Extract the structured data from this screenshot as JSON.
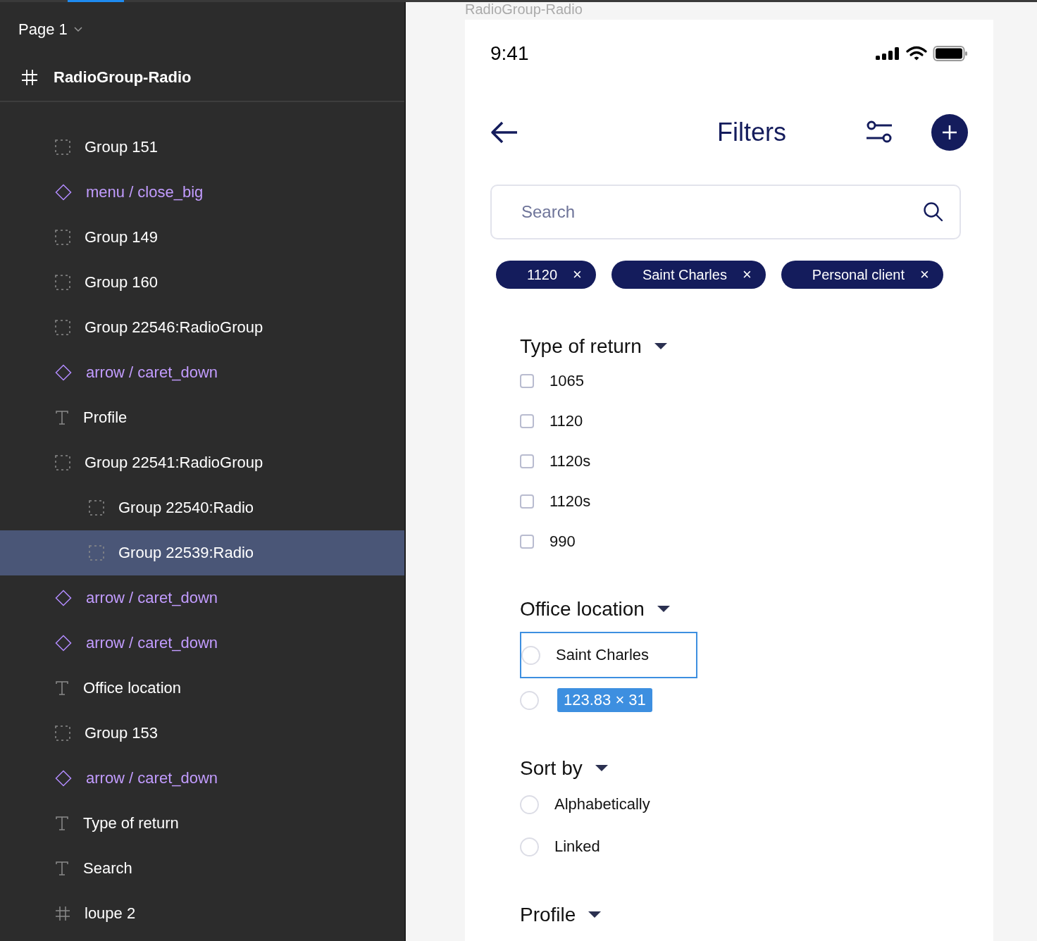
{
  "layers_panel": {
    "page": "Page 1",
    "frame": "RadioGroup-Radio",
    "items": [
      {
        "label": "Group 151",
        "kind": "group",
        "selected": false
      },
      {
        "label": "menu / close_big",
        "kind": "component",
        "selected": false
      },
      {
        "label": "Group 149",
        "kind": "group",
        "selected": false
      },
      {
        "label": "Group 160",
        "kind": "group",
        "selected": false
      },
      {
        "label": "Group 22546:RadioGroup",
        "kind": "group",
        "selected": false
      },
      {
        "label": "arrow / caret_down",
        "kind": "component",
        "selected": false
      },
      {
        "label": "Profile",
        "kind": "text",
        "selected": false
      },
      {
        "label": "Group 22541:RadioGroup",
        "kind": "group",
        "selected": false,
        "children": [
          {
            "label": "Group 22540:Radio",
            "kind": "group",
            "selected": false
          },
          {
            "label": "Group 22539:Radio",
            "kind": "group",
            "selected": true
          }
        ]
      },
      {
        "label": "arrow / caret_down",
        "kind": "component",
        "selected": false
      },
      {
        "label": "arrow / caret_down",
        "kind": "component",
        "selected": false
      },
      {
        "label": "Office location",
        "kind": "text",
        "selected": false
      },
      {
        "label": "Group 153",
        "kind": "group",
        "selected": false
      },
      {
        "label": "arrow / caret_down",
        "kind": "component",
        "selected": false
      },
      {
        "label": "Type of return",
        "kind": "text",
        "selected": false
      },
      {
        "label": "Search",
        "kind": "text",
        "selected": false
      },
      {
        "label": "loupe 2",
        "kind": "frame",
        "selected": false
      }
    ]
  },
  "canvas": {
    "frame_label": "RadioGroup-Radio",
    "status_bar": {
      "time": "9:41"
    },
    "title": "Filters",
    "search": {
      "placeholder": "Search"
    },
    "chips": [
      "1120",
      "Saint Charles",
      "Personal client"
    ],
    "chip_close": "×",
    "sections": [
      {
        "title": "Type of return",
        "kind": "checkbox",
        "options": [
          {
            "label": "1065",
            "checked": false
          },
          {
            "label": "1120",
            "checked": false
          },
          {
            "label": "1120s",
            "checked": false
          },
          {
            "label": "1120s",
            "checked": false
          },
          {
            "label": "990",
            "checked": false
          }
        ]
      },
      {
        "title": "Office location",
        "kind": "radio",
        "options": [
          {
            "label": "Saint Charles",
            "checked": false,
            "selected": true
          },
          {
            "checked": false,
            "selected": false,
            "measure": "123.83 × 31"
          }
        ]
      },
      {
        "title": "Sort by",
        "kind": "radio",
        "options": [
          {
            "label": "Alphabetically",
            "checked": false
          },
          {
            "label": "Linked",
            "checked": false
          }
        ]
      },
      {
        "title": "Profile"
      }
    ]
  }
}
